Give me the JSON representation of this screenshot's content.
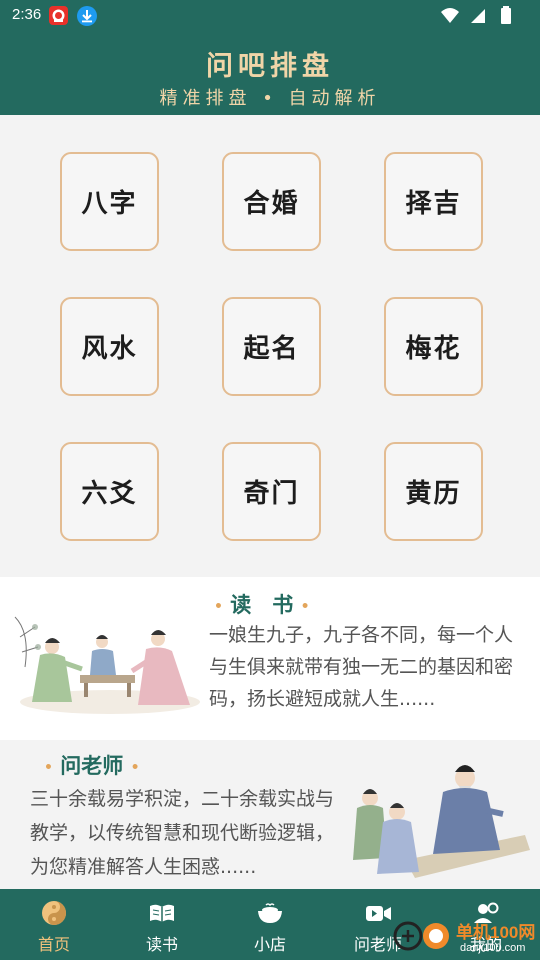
{
  "status_bar": {
    "time": "2:36"
  },
  "header": {
    "title": "问吧排盘",
    "subtitle": "精准排盘 • 自动解析"
  },
  "grid": {
    "items": [
      {
        "label": "八字"
      },
      {
        "label": "合婚"
      },
      {
        "label": "择吉"
      },
      {
        "label": "风水"
      },
      {
        "label": "起名"
      },
      {
        "label": "梅花"
      },
      {
        "label": "六爻"
      },
      {
        "label": "奇门"
      },
      {
        "label": "黄历"
      }
    ]
  },
  "read_section": {
    "heading": "读　书",
    "text": "一娘生九子，九子各不同，每一个人与生俱来就带有独一无二的基因和密码，扬长避短成就人生......"
  },
  "teacher_section": {
    "heading": "问老师",
    "text": "三十余载易学积淀，二十余载实战与教学，以传统智慧和现代断验逻辑，为您精准解答人生困惑......"
  },
  "bottom_nav": {
    "items": [
      {
        "label": "首页",
        "icon": "yin-yang-icon",
        "active": true
      },
      {
        "label": "读书",
        "icon": "open-book-icon",
        "active": false
      },
      {
        "label": "小店",
        "icon": "bowl-icon",
        "active": false
      },
      {
        "label": "问老师",
        "icon": "video-camera-icon",
        "active": false
      },
      {
        "label": "我的",
        "icon": "user-gear-icon",
        "active": false
      }
    ]
  },
  "watermark": {
    "text": "单机100网",
    "sub": "danji100.com"
  },
  "colors": {
    "primary": "#236a5f",
    "accent_gold": "#f0d5a8",
    "tile_border": "#e3bc92",
    "nav_active": "#f0c27d"
  }
}
